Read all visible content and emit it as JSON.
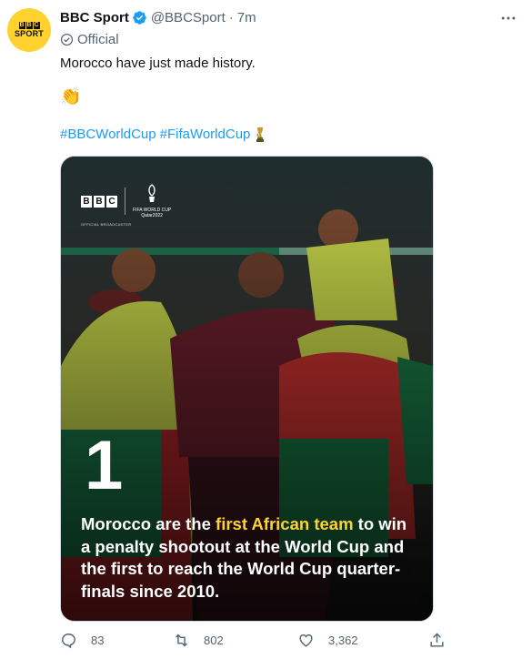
{
  "account": {
    "name": "BBC Sport",
    "handle": "@BBCSport",
    "separator": "·",
    "time": "7m",
    "label": "Official",
    "avatar_text": {
      "letters": [
        "B",
        "B",
        "C"
      ],
      "sport": "SPORT"
    }
  },
  "tweet": {
    "text": "Morocco have just made history.",
    "emoji": "👏",
    "hashtags": [
      "#BBCWorldCup",
      "#FifaWorldCup"
    ],
    "trophy_icon": "trophy-icon"
  },
  "media": {
    "brand_letters": [
      "B",
      "B",
      "C"
    ],
    "fifa_text": "FIFA WORLD CUP",
    "fifa_text2": "Qatar2022",
    "broadcaster": "OFFICIAL BROADCASTER",
    "big_number": "1",
    "caption_before": "Morocco are the ",
    "caption_highlight": "first African team",
    "caption_after": " to win a penalty shootout at the World Cup and the first to reach the World Cup quarter-finals since 2010."
  },
  "actions": {
    "replies": "83",
    "retweets": "802",
    "likes": "3,362"
  },
  "colors": {
    "accent": "#1d9bf0",
    "avatar_bg": "#ffd230",
    "highlight": "#ffd230",
    "verified": "#1d9bf0"
  }
}
